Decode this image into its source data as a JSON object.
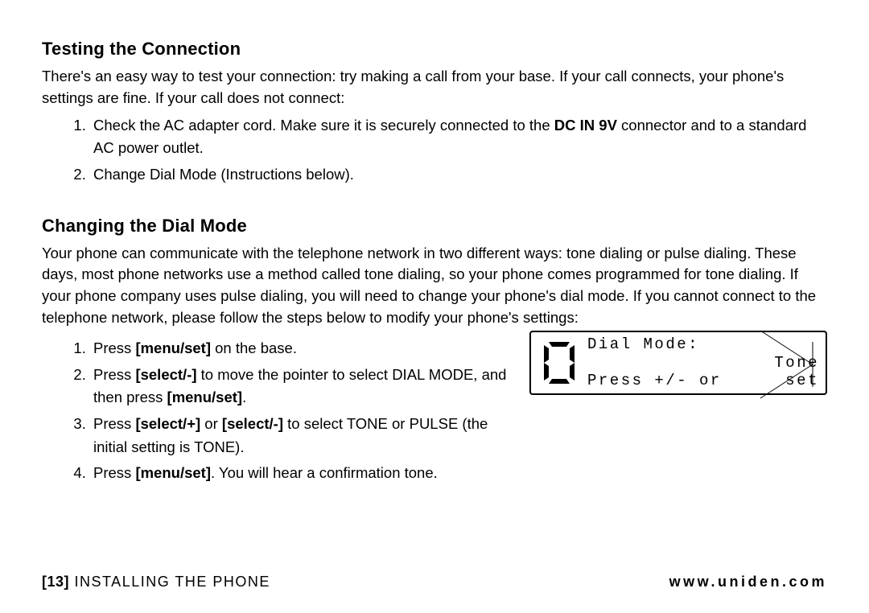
{
  "section1": {
    "heading": "Testing the Connection",
    "intro": "There's an easy way to test your connection: try making a call from your base. If your call connects, your phone's settings are fine. If your call does not connect:",
    "steps": [
      {
        "pre": "Check the AC adapter cord. Make sure it is securely connected to the ",
        "bold": "DC IN 9V",
        "post": " connector and to a standard AC power outlet."
      },
      {
        "text": "Change Dial Mode (Instructions below)."
      }
    ]
  },
  "section2": {
    "heading": "Changing the Dial Mode",
    "intro": "Your phone can communicate with the telephone network in two different ways: tone dialing or pulse dialing. These days, most phone networks use a method called tone dialing, so your phone comes programmed for tone dialing. If your phone company uses pulse dialing, you will need to change your phone's dial mode. If you cannot connect to the telephone network, please follow the steps below to modify your phone's settings:",
    "steps": [
      {
        "parts": [
          {
            "t": "Press "
          },
          {
            "b": "[menu/set]"
          },
          {
            "t": " on the base."
          }
        ]
      },
      {
        "parts": [
          {
            "t": "Press "
          },
          {
            "b": "[select/-]"
          },
          {
            "t": " to move the pointer to select DIAL MODE, and then press "
          },
          {
            "b": "[menu/set]"
          },
          {
            "t": "."
          }
        ]
      },
      {
        "parts": [
          {
            "t": "Press "
          },
          {
            "b": "[select/+]"
          },
          {
            "t": " or "
          },
          {
            "b": "[select/-]"
          },
          {
            "t": " to select TONE or PULSE (the initial setting is TONE)."
          }
        ]
      },
      {
        "parts": [
          {
            "t": "Press "
          },
          {
            "b": "[menu/set]"
          },
          {
            "t": ". You will hear a confirmation tone."
          }
        ]
      }
    ]
  },
  "lcd": {
    "digit": "0",
    "line1": "Dial Mode:",
    "line2_left": "Press +/- or",
    "line2_right": "Tone",
    "line3_right": "set"
  },
  "footer": {
    "page_num": "[13]",
    "chapter": " INSTALLING THE PHONE",
    "url": "www.uniden.com"
  }
}
